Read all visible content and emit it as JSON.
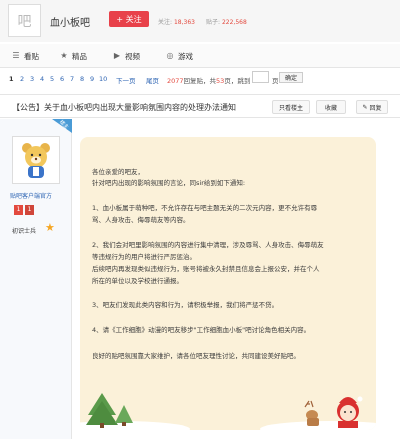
{
  "header": {
    "forum_logo_char": "吧",
    "forum_name": "血小板吧",
    "follow_label": "+ 关注",
    "follow_stat_label": "关注:",
    "follow_count": "18,363",
    "post_stat_label": "贴子:",
    "post_count": "222,568"
  },
  "nav": {
    "items": [
      {
        "label": "看贴",
        "icon": "list-icon"
      },
      {
        "label": "精品",
        "icon": "star-icon"
      },
      {
        "label": "视频",
        "icon": "video-icon"
      },
      {
        "label": "游戏",
        "icon": "gamepad-icon"
      }
    ]
  },
  "pager": {
    "current": "1",
    "pages": [
      "2",
      "3",
      "4",
      "5",
      "6",
      "7",
      "8",
      "9",
      "10"
    ],
    "next_label": "下一页",
    "last_label": "尾页",
    "reply_count": "2077",
    "reply_text": "回复贴，共",
    "page_count": "53",
    "page_text": "页，跳到",
    "page_unit": "页",
    "go_label": "确定"
  },
  "post": {
    "title": "【公告】关于血小板吧内出现大量影响氛围内容的处理办法通知",
    "btn_author": "只看楼主",
    "btn_collect": "收藏",
    "btn_reply": "回复",
    "corner_label": "楼主"
  },
  "author": {
    "name": "贴吧客户端官方",
    "badge_1": "1",
    "badge_2": "1",
    "rank": "初识士兵"
  },
  "notice": {
    "greeting": "各位亲爱的吧友，",
    "intro": "针对吧内出现的影响氛围的言论，同sir给到如下通知:",
    "p1a": "1、血小板属于萌种吧，不允许存在与吧主题无关的二次元内容，更不允许有辱",
    "p1b": "骂、人身攻击、侮辱萌友等内容。",
    "p2a": "2、我们会对吧里影响氛围的内容进行集中清理，涉及辱骂、人身攻击、侮辱萌友",
    "p2b": "等违规行为的用户将进行严厉惩治。",
    "p2c": "后续吧内再发现类似违规行为，账号将被永久封禁且信息会上报公安，并在个人",
    "p2d": "所在的单位以及学校进行通报。",
    "p3": "3、吧友们发现此类内容和行为，请积极举报，我们将严惩不贷。",
    "p4": "4、请《工作细胞》动漫的吧友移步\"工作细胞血小板\"吧讨论角色相关内容。",
    "closing": "良好的贴吧氛围靠大家维护，请各位吧友理性讨论，共同建设美好贴吧。"
  },
  "colors": {
    "accent_red": "#e8414a",
    "link_blue": "#2d64b3",
    "notice_bg": "#fbf1d9"
  }
}
